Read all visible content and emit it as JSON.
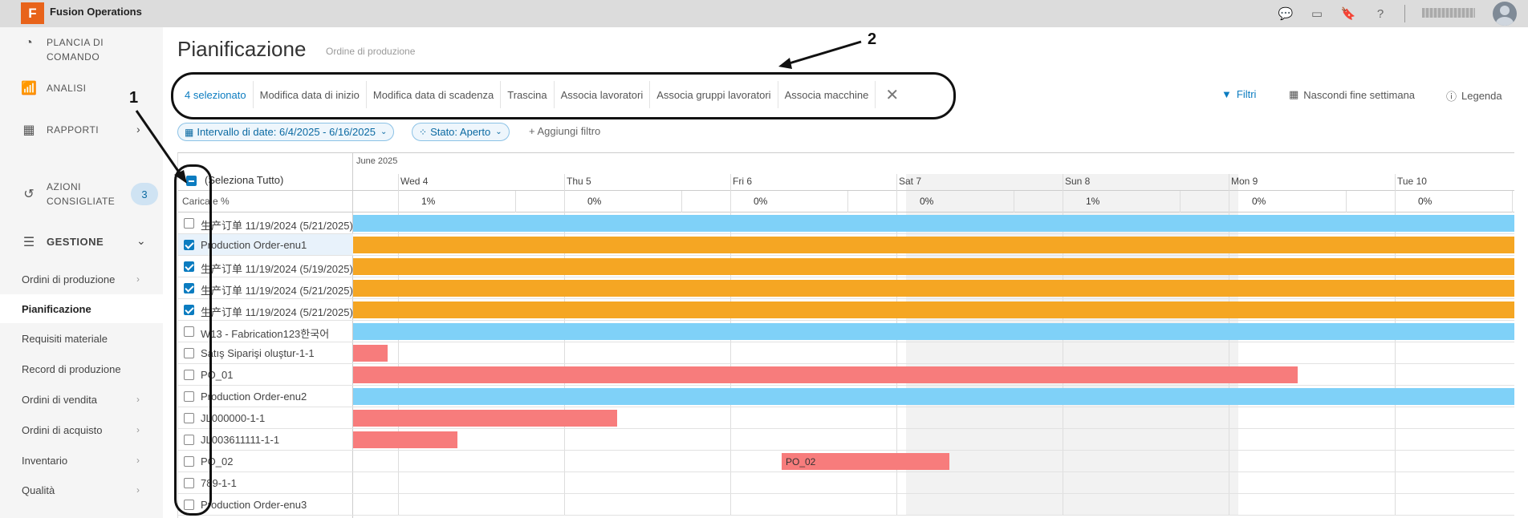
{
  "app": {
    "logo_letter": "F",
    "name": "Fusion Operations"
  },
  "topbar_icons": [
    "chat-icon",
    "tablet-icon",
    "bookmark-icon",
    "help-icon"
  ],
  "sidebar": {
    "dashboard": "PLANCIA DI COMANDO",
    "analytics": "ANALISI",
    "reports": "RAPPORTI",
    "actions": "AZIONI CONSIGLIATE",
    "actions_badge": "3",
    "section": "GESTIONE",
    "items": [
      {
        "label": "Ordini di produzione",
        "chevron": true
      },
      {
        "label": "Pianificazione",
        "chevron": false,
        "active": true
      },
      {
        "label": "Requisiti materiale",
        "chevron": false
      },
      {
        "label": "Record di produzione",
        "chevron": false
      },
      {
        "label": "Ordini di vendita",
        "chevron": true
      },
      {
        "label": "Ordini di acquisto",
        "chevron": true
      },
      {
        "label": "Inventario",
        "chevron": true
      },
      {
        "label": "Qualità",
        "chevron": true
      }
    ]
  },
  "page": {
    "title": "Pianificazione",
    "subtitle": "Ordine di produzione"
  },
  "toolbar": {
    "selected": "4 selezionato",
    "start_date": "Modifica data di inizio",
    "due_date": "Modifica data di scadenza",
    "drag": "Trascina",
    "workers": "Associa lavoratori",
    "worker_groups": "Associa gruppi lavoratori",
    "machines": "Associa macchine",
    "close": "✕"
  },
  "right_tools": {
    "filters": "Filtri",
    "hide_weekend": "Nascondi fine settimana",
    "legend": "Legenda"
  },
  "filters": {
    "date_range": "Intervallo di date: 6/4/2025 - 6/16/2025",
    "status": "Stato: Aperto",
    "add": "+ Aggiungi filtro"
  },
  "grid": {
    "select_all": "(Seleziona Tutto)",
    "load_label": "Carica  e %",
    "month": "June 2025",
    "days": [
      "Wed 4",
      "Thu 5",
      "Fri 6",
      "Sat 7",
      "Sun 8",
      "Mon 9",
      "Tue 10"
    ],
    "loads": [
      "1%",
      "0%",
      "0%",
      "0%",
      "1%",
      "0%",
      "0%"
    ],
    "rows": [
      {
        "name": "生产订单 11/19/2024 (5/21/2025)",
        "checked": false,
        "color": "blue",
        "start": 0,
        "end": 1
      },
      {
        "name": "Production Order-enu1",
        "checked": true,
        "color": "orange",
        "start": 0,
        "end": 1
      },
      {
        "name": "生产订单 11/19/2024 (5/19/2025)",
        "checked": true,
        "color": "orange",
        "start": 0,
        "end": 1
      },
      {
        "name": "生产订单 11/19/2024 (5/21/2025)",
        "checked": true,
        "color": "orange",
        "start": 0,
        "end": 1
      },
      {
        "name": "生产订单 11/19/2024 (5/21/2025)",
        "checked": true,
        "color": "orange",
        "start": 0,
        "end": 1
      },
      {
        "name": "W13 - Fabrication123한국어",
        "checked": false,
        "color": "blue",
        "start": 0,
        "end": 1
      },
      {
        "name": "Satış Siparişi oluştur-1-1",
        "checked": false,
        "color": "red",
        "start": 0,
        "end": 0.03
      },
      {
        "name": "PO_01",
        "checked": false,
        "color": "red",
        "start": 0,
        "end": 0.813
      },
      {
        "name": "Production Order-enu2",
        "checked": false,
        "color": "blue",
        "start": 0,
        "end": 1
      },
      {
        "name": "JL000000-1-1",
        "checked": false,
        "color": "red",
        "start": 0,
        "end": 0.227
      },
      {
        "name": "JL003611111-1-1",
        "checked": false,
        "color": "red",
        "start": 0,
        "end": 0.09
      },
      {
        "name": "PO_02",
        "checked": false,
        "color": "red",
        "start": 0.369,
        "end": 0.513,
        "label": "PO_02"
      },
      {
        "name": "789-1-1",
        "checked": false,
        "color": null
      },
      {
        "name": "Production Order-enu3",
        "checked": false,
        "color": null
      }
    ]
  },
  "annotations": {
    "one": "1",
    "two": "2"
  },
  "colors": {
    "accent": "#0b7cc0",
    "blue_bar": "#7fd1f8",
    "orange_bar": "#f5a623",
    "red_bar": "#f77c7c"
  }
}
